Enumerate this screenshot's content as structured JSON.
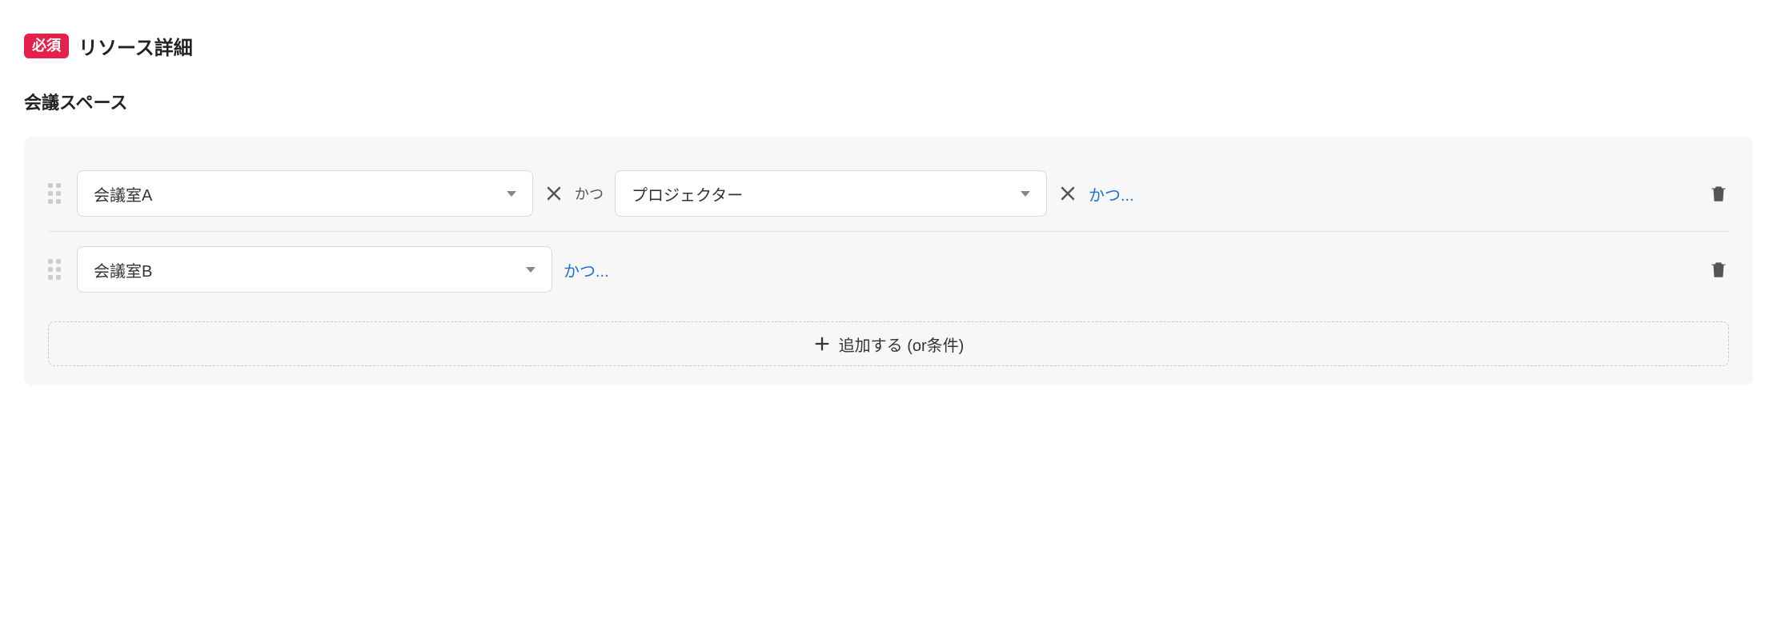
{
  "header": {
    "badge": "必須",
    "title": "リソース詳細"
  },
  "subtitle": "会議スペース",
  "rows": [
    {
      "selects": [
        {
          "value": "会議室A"
        },
        {
          "value": "プロジェクター"
        }
      ],
      "conjunction": "かつ",
      "add_link": "かつ..."
    },
    {
      "selects": [
        {
          "value": "会議室B"
        }
      ],
      "add_link": "かつ..."
    }
  ],
  "add_button": "追加する (or条件)"
}
